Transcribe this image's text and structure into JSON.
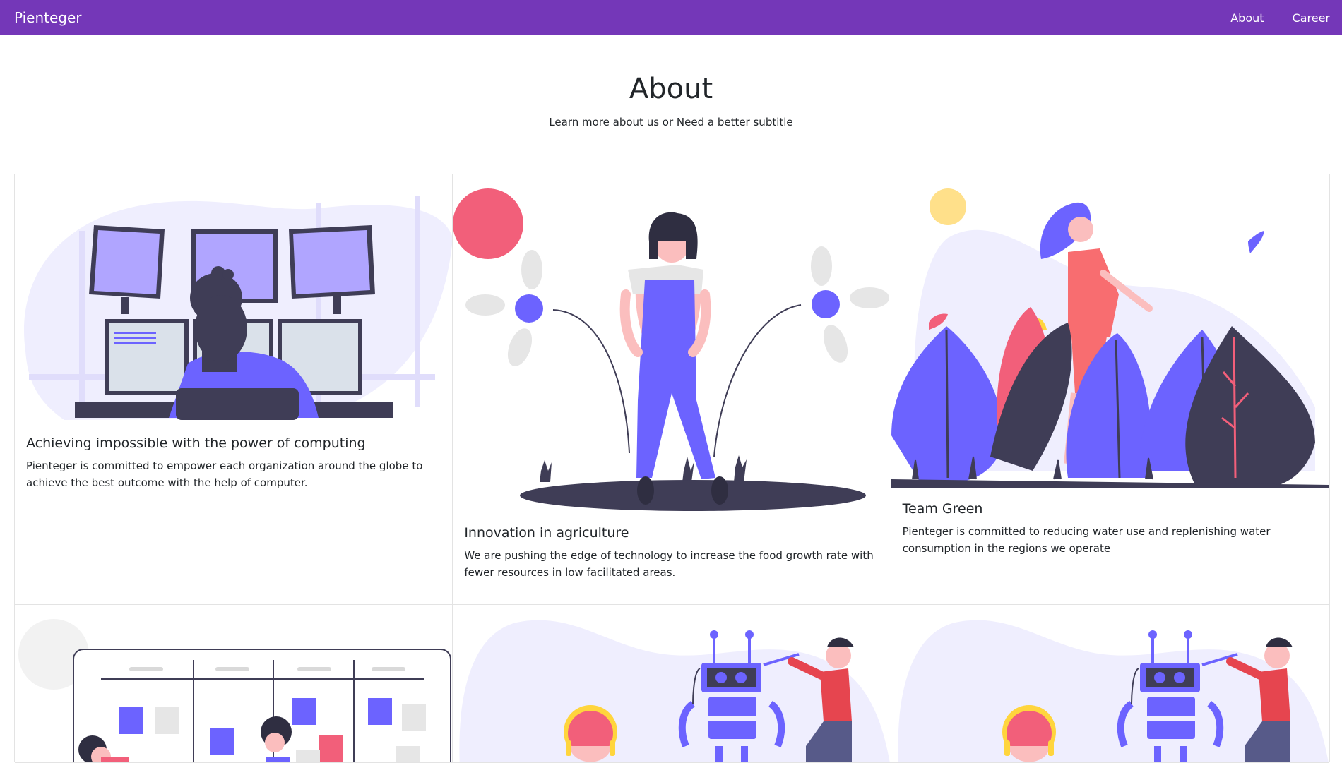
{
  "brand": "Pienteger",
  "nav": {
    "about": "About",
    "career": "Career"
  },
  "hero": {
    "title": "About",
    "subtitle": "Learn more about us or Need a better subtitle"
  },
  "cards": [
    {
      "title": "Achieving impossible with the power of computing",
      "text": "Pienteger is committed to empower each organization around the globe to achieve the best outcome with the help of computer."
    },
    {
      "title": "Innovation in agriculture",
      "text": "We are pushing the edge of technology to increase the food growth rate with fewer resources in low facilitated areas."
    },
    {
      "title": "Team Green",
      "text": "Pienteger is committed to reducing water use and replenishing water consumption in the regions we operate"
    }
  ],
  "colors": {
    "navbar": "#7437b8",
    "accent": "#6c63ff",
    "pink": "#f25f7a",
    "dark": "#3f3d56",
    "lavender": "#efeefe"
  }
}
